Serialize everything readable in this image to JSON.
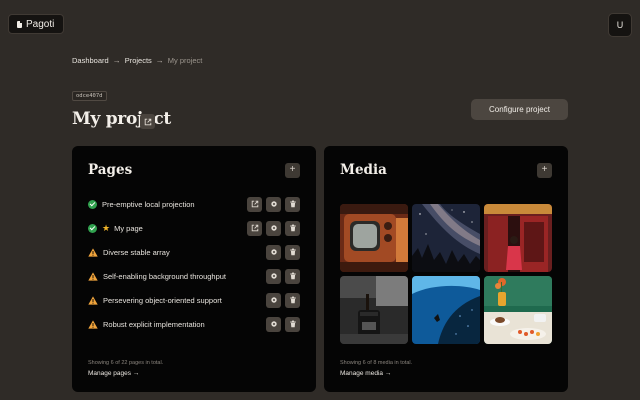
{
  "brand": {
    "name": "Pagoti"
  },
  "user": {
    "initial": "U"
  },
  "breadcrumb": {
    "items": [
      {
        "label": "Dashboard"
      },
      {
        "label": "Projects"
      },
      {
        "label": "My project"
      }
    ],
    "separator": "→"
  },
  "project": {
    "id": "odce407d",
    "title": "My project",
    "configure_label": "Configure project"
  },
  "pages": {
    "title": "Pages",
    "add_label": "+",
    "items": [
      {
        "label": "Pre-emptive local projection",
        "status": "published",
        "starred": false
      },
      {
        "label": "My page",
        "status": "published",
        "starred": true
      },
      {
        "label": "Diverse stable array",
        "status": "warning",
        "starred": false
      },
      {
        "label": "Self-enabling background throughput",
        "status": "warning",
        "starred": false
      },
      {
        "label": "Persevering object-oriented support",
        "status": "warning",
        "starred": false
      },
      {
        "label": "Robust explicit implementation",
        "status": "warning",
        "starred": false
      }
    ],
    "summary": "Showing 6 of 22 pages in total.",
    "manage_label": "Manage pages →"
  },
  "media": {
    "title": "Media",
    "add_label": "+",
    "items": [
      {
        "name": "vintage-tv-photo"
      },
      {
        "name": "milky-way-night-sky-photo"
      },
      {
        "name": "red-door-woman-photo"
      },
      {
        "name": "coffee-pour-photo"
      },
      {
        "name": "underwater-diver-photo"
      },
      {
        "name": "breakfast-table-photo"
      }
    ],
    "summary": "Showing 6 of 8 media in total.",
    "manage_label": "Manage media →"
  },
  "colors": {
    "background": "#2f2b27",
    "card": "#050505",
    "success": "#30a14e",
    "warning": "#f0a43c",
    "star": "#f0b429"
  }
}
